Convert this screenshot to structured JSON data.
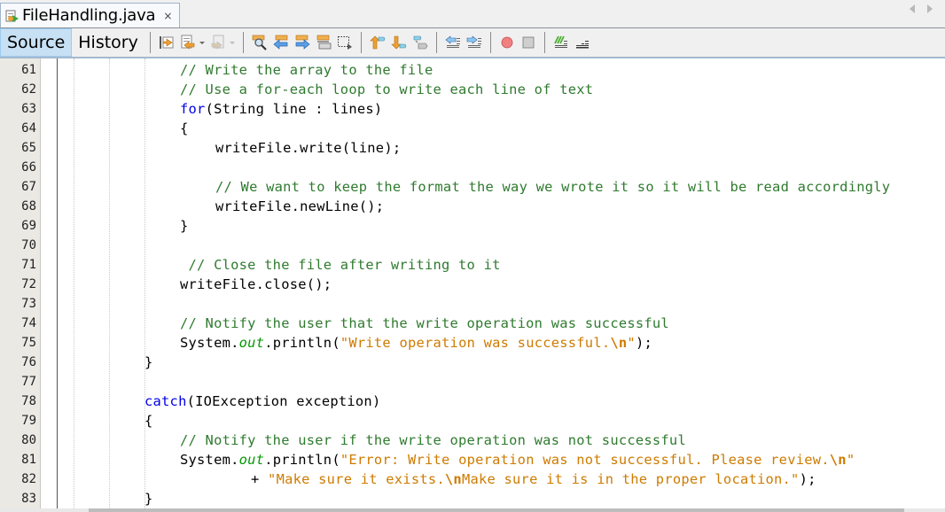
{
  "tab": {
    "title": "FileHandling.java",
    "close_label": "×",
    "icon": "java-file-icon"
  },
  "nav": {
    "left": "scroll-tabs-left-icon",
    "right": "scroll-tabs-right-icon"
  },
  "toolbar": {
    "source_label": "Source",
    "history_label": "History",
    "icons": [
      "last-edit-icon",
      "back-icon",
      "forward-icon",
      "find-selection-icon",
      "find-previous-icon",
      "find-next-icon",
      "toggle-highlight-icon",
      "toggle-rect-selection-icon",
      "previous-bookmark-icon",
      "next-bookmark-icon",
      "toggle-bookmark-icon",
      "shift-left-icon",
      "shift-right-icon",
      "start-macro-icon",
      "stop-macro-icon",
      "comment-icon",
      "uncomment-icon"
    ]
  },
  "editor": {
    "lines": [
      {
        "n": "61",
        "segs": [
          [
            "cm",
            "// Write the array to the file"
          ]
        ],
        "indent": 3
      },
      {
        "n": "62",
        "segs": [
          [
            "cm",
            "// Use a for-each loop to write each line of text"
          ]
        ],
        "indent": 3
      },
      {
        "n": "63",
        "segs": [
          [
            "kw",
            "for"
          ],
          [
            "",
            "(String line : lines)"
          ]
        ],
        "indent": 3
      },
      {
        "n": "64",
        "segs": [
          [
            "",
            "{"
          ]
        ],
        "indent": 3
      },
      {
        "n": "65",
        "segs": [
          [
            "",
            "writeFile.write(line);"
          ]
        ],
        "indent": 4
      },
      {
        "n": "66",
        "segs": [],
        "indent": 0
      },
      {
        "n": "67",
        "segs": [
          [
            "cm",
            "// We want to keep the format the way we wrote it so it will be read accordingly"
          ]
        ],
        "indent": 4
      },
      {
        "n": "68",
        "segs": [
          [
            "",
            "writeFile.newLine();"
          ]
        ],
        "indent": 4
      },
      {
        "n": "69",
        "segs": [
          [
            "",
            "}"
          ]
        ],
        "indent": 3
      },
      {
        "n": "70",
        "segs": [],
        "indent": 0
      },
      {
        "n": "71",
        "segs": [
          [
            "cm",
            " // Close the file after writing to it"
          ]
        ],
        "indent": 3
      },
      {
        "n": "72",
        "segs": [
          [
            "",
            "writeFile.close();"
          ]
        ],
        "indent": 3
      },
      {
        "n": "73",
        "segs": [],
        "indent": 0
      },
      {
        "n": "74",
        "segs": [
          [
            "cm",
            "// Notify the user that the write operation was successful"
          ]
        ],
        "indent": 3
      },
      {
        "n": "75",
        "segs": [
          [
            "",
            "System."
          ],
          [
            "fld",
            "out"
          ],
          [
            "",
            ".println("
          ],
          [
            "str",
            "\"Write operation was successful."
          ],
          [
            "esc",
            "\\n"
          ],
          [
            "str",
            "\""
          ],
          [
            "",
            ");"
          ]
        ],
        "indent": 3
      },
      {
        "n": "76",
        "segs": [
          [
            "",
            "}"
          ]
        ],
        "indent": 2
      },
      {
        "n": "77",
        "segs": [],
        "indent": 0
      },
      {
        "n": "78",
        "segs": [
          [
            "kw",
            "catch"
          ],
          [
            "",
            "(IOException exception)"
          ]
        ],
        "indent": 2
      },
      {
        "n": "79",
        "segs": [
          [
            "",
            "{"
          ]
        ],
        "indent": 2
      },
      {
        "n": "80",
        "segs": [
          [
            "cm",
            "// Notify the user if the write operation was not successful"
          ]
        ],
        "indent": 3
      },
      {
        "n": "81",
        "segs": [
          [
            "",
            "System."
          ],
          [
            "fld",
            "out"
          ],
          [
            "",
            ".println("
          ],
          [
            "str",
            "\"Error: Write operation was not successful. Please review."
          ],
          [
            "esc",
            "\\n"
          ],
          [
            "str",
            "\""
          ]
        ],
        "indent": 3
      },
      {
        "n": "82",
        "segs": [
          [
            "",
            "+ "
          ],
          [
            "str",
            "\"Make sure it exists."
          ],
          [
            "esc",
            "\\n"
          ],
          [
            "str",
            "Make sure it is in the proper location.\""
          ],
          [
            "",
            ");"
          ]
        ],
        "indent": 5
      },
      {
        "n": "83",
        "segs": [
          [
            "",
            "}"
          ]
        ],
        "indent": 2
      }
    ]
  }
}
